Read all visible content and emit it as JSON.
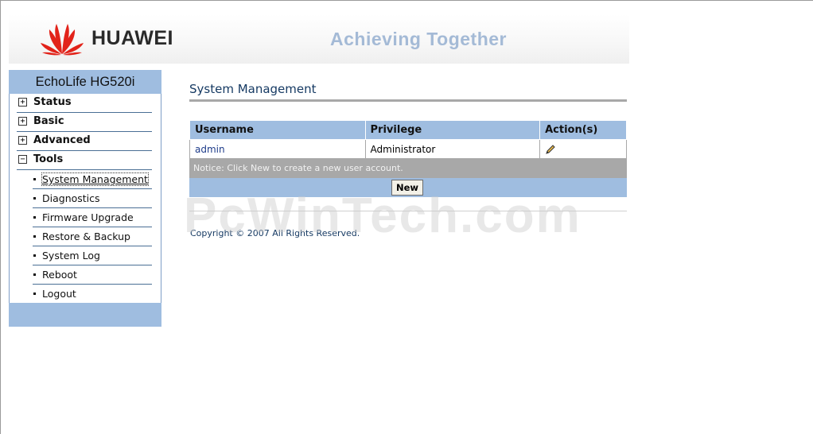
{
  "header": {
    "brand": "HUAWEI",
    "slogan": "Achieving Together"
  },
  "sidebar": {
    "model": "EchoLife HG520i",
    "menu": [
      {
        "label": "Status",
        "expander": "+"
      },
      {
        "label": "Basic",
        "expander": "+"
      },
      {
        "label": "Advanced",
        "expander": "+"
      },
      {
        "label": "Tools",
        "expander": "−"
      }
    ],
    "tools_items": [
      {
        "label": "System Management",
        "active": true
      },
      {
        "label": "Diagnostics"
      },
      {
        "label": "Firmware Upgrade"
      },
      {
        "label": "Restore & Backup"
      },
      {
        "label": "System Log"
      },
      {
        "label": "Reboot"
      },
      {
        "label": "Logout"
      }
    ]
  },
  "main": {
    "title": "System Management",
    "table": {
      "headers": [
        "Username",
        "Privilege",
        "Action(s)"
      ],
      "rows": [
        {
          "username": "admin",
          "privilege": "Administrator",
          "action_icon": "pencil-icon"
        }
      ]
    },
    "notice": "Notice: Click New to create a new user account.",
    "new_button": "New",
    "copyright": "Copyright © 2007 All Rights Reserved."
  },
  "watermark": "PcWinTech.com",
  "colors": {
    "nav_blue": "#9fbde0",
    "title_blue": "#163a63",
    "logo_red": "#e2231a",
    "notice_gray": "#a8a8a8"
  }
}
